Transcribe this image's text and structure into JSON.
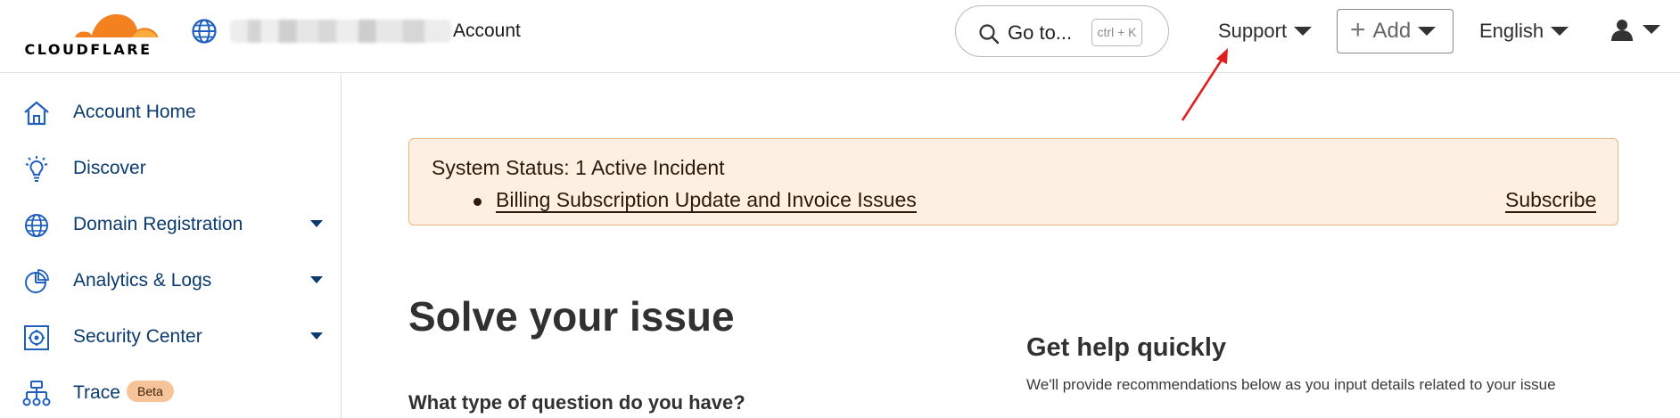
{
  "header": {
    "logo_text": "CLOUDFLARE",
    "account_label": "Account",
    "goto": {
      "label": "Go to...",
      "shortcut": "ctrl + K"
    },
    "support_label": "Support",
    "add_label": "Add",
    "language_label": "English"
  },
  "sidebar": {
    "items": [
      {
        "label": "Account Home",
        "icon": "home-icon"
      },
      {
        "label": "Discover",
        "icon": "lightbulb-icon"
      },
      {
        "label": "Domain Registration",
        "icon": "globe-icon",
        "expandable": true
      },
      {
        "label": "Analytics & Logs",
        "icon": "pie-chart-icon",
        "expandable": true
      },
      {
        "label": "Security Center",
        "icon": "security-center-icon",
        "expandable": true
      },
      {
        "label": "Trace",
        "icon": "trace-icon",
        "badge": "Beta"
      }
    ]
  },
  "status_banner": {
    "title": "System Status: 1 Active Incident",
    "incident_link": "Billing Subscription Update and Invoice Issues",
    "subscribe_label": "Subscribe"
  },
  "main": {
    "heading": "Solve your issue",
    "question_label": "What type of question do you have?",
    "help_heading": "Get help quickly",
    "help_text": "We'll provide recommendations below as you input details related to your issue"
  },
  "colors": {
    "cloudflare_orange": "#f48120",
    "cloudflare_orange_light": "#faad3f",
    "sidebar_text": "#0b3b6e",
    "banner_bg": "#fdefe2",
    "banner_border": "#eab480",
    "beta_badge": "#f7c49a",
    "annotation_arrow": "#e02020"
  }
}
